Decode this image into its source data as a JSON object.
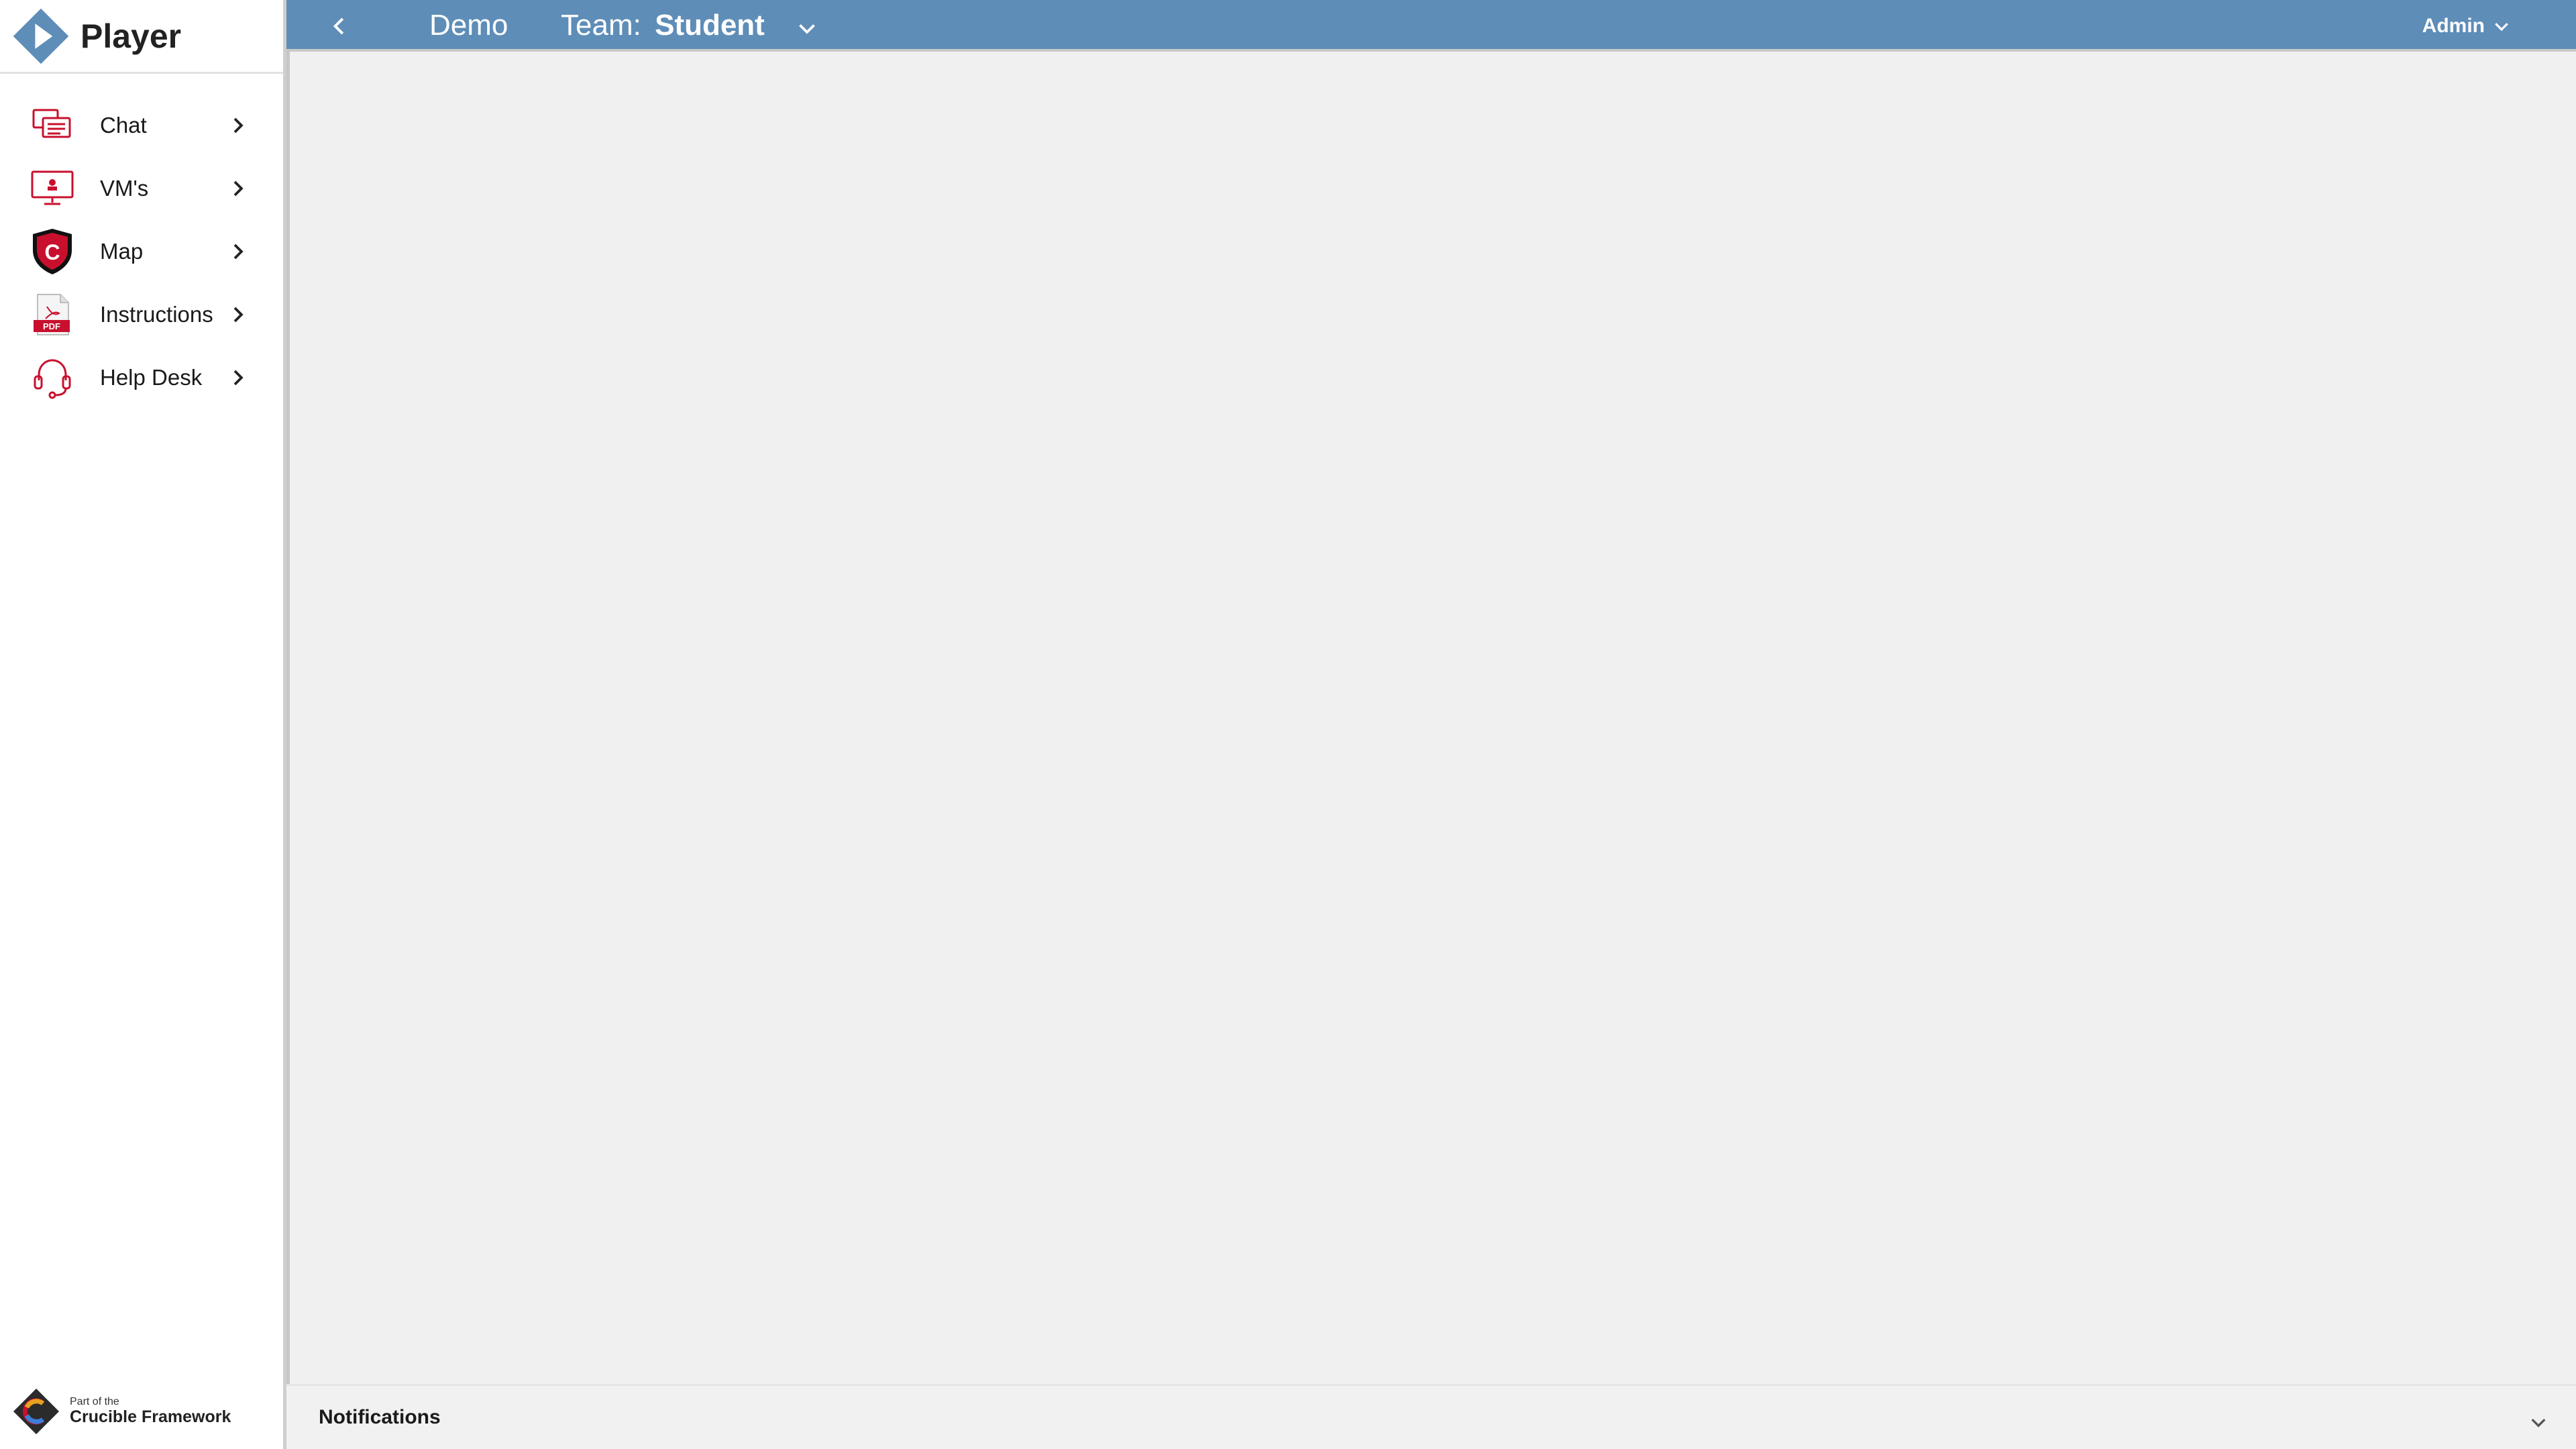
{
  "app": {
    "title": "Player"
  },
  "sidebar": {
    "items": [
      {
        "label": "Chat",
        "icon": "chat-icon"
      },
      {
        "label": "VM's",
        "icon": "monitor-icon"
      },
      {
        "label": "Map",
        "icon": "shield-c-icon"
      },
      {
        "label": "Instructions",
        "icon": "pdf-icon"
      },
      {
        "label": "Help Desk",
        "icon": "headset-icon"
      }
    ],
    "footer": {
      "line1": "Part of the",
      "line2": "Crucible Framework"
    }
  },
  "topbar": {
    "view_name": "Demo",
    "team_label": "Team:",
    "team_value": "Student",
    "user": "Admin"
  },
  "notifications": {
    "label": "Notifications"
  },
  "colors": {
    "accent": "#5e8db8",
    "icon_red": "#c8102e"
  }
}
